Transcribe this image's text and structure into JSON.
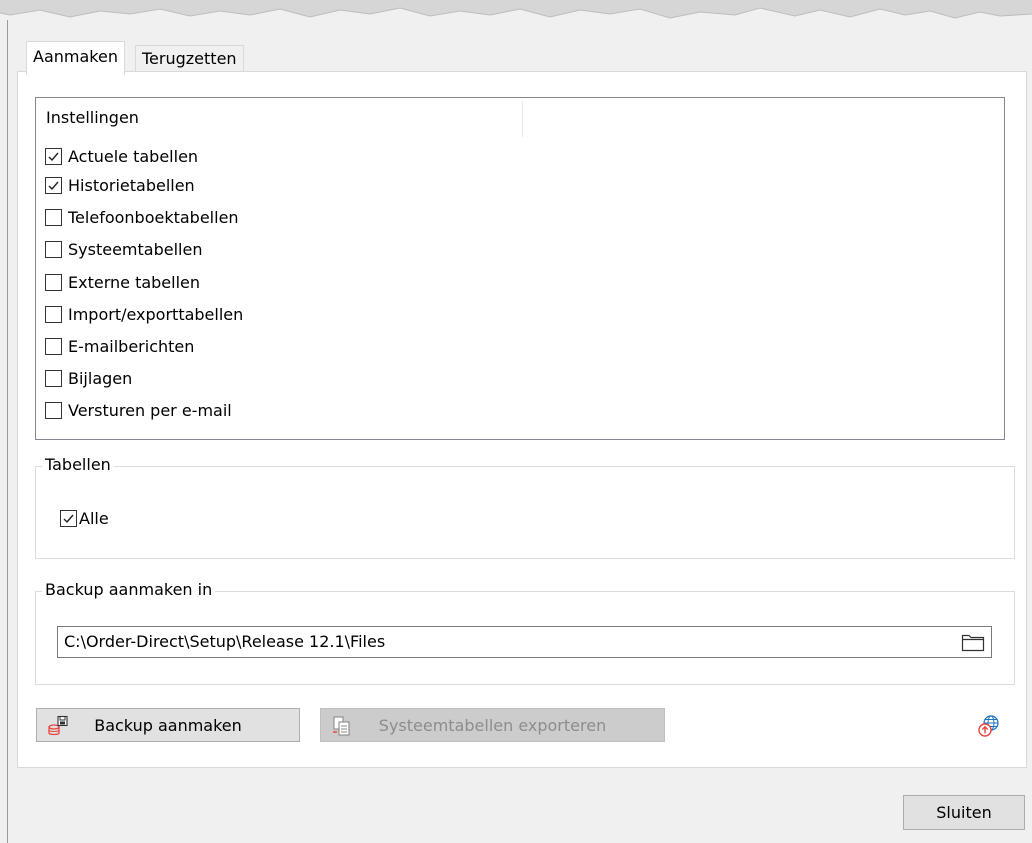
{
  "tabs": [
    {
      "label": "Aanmaken",
      "active": true
    },
    {
      "label": "Terugzetten",
      "active": false
    }
  ],
  "settings": {
    "header": "Instellingen",
    "items": [
      {
        "label": "Actuele tabellen",
        "checked": true
      },
      {
        "label": "Historietabellen",
        "checked": true
      },
      {
        "label": "Telefoonboektabellen",
        "checked": false
      },
      {
        "label": "Systeemtabellen",
        "checked": false
      },
      {
        "label": "Externe tabellen",
        "checked": false
      },
      {
        "label": "Import/exporttabellen",
        "checked": false
      },
      {
        "label": "E-mailberichten",
        "checked": false
      },
      {
        "label": "Bijlagen",
        "checked": false
      },
      {
        "label": "Versturen per e-mail",
        "checked": false
      }
    ]
  },
  "tables": {
    "title": "Tabellen",
    "all_label": "Alle",
    "all_checked": true
  },
  "backup_location": {
    "title": "Backup aanmaken in",
    "path": "C:\\Order-Direct\\Setup\\Release 12.1\\Files",
    "browse_icon": "folder-icon"
  },
  "actions": {
    "backup_label": "Backup aanmaken",
    "backup_icon": "database-save-icon",
    "export_label": "Systeemtabellen exporteren",
    "export_icon": "copy-export-icon",
    "export_enabled": false,
    "upload_icon": "globe-upload-icon"
  },
  "footer": {
    "close_label": "Sluiten"
  },
  "colors": {
    "panel_bg": "#ffffff",
    "window_bg": "#f0f0f0",
    "button_bg": "#e1e1e1",
    "disabled_button_bg": "#cccccc",
    "accent_red": "#e8453c"
  }
}
